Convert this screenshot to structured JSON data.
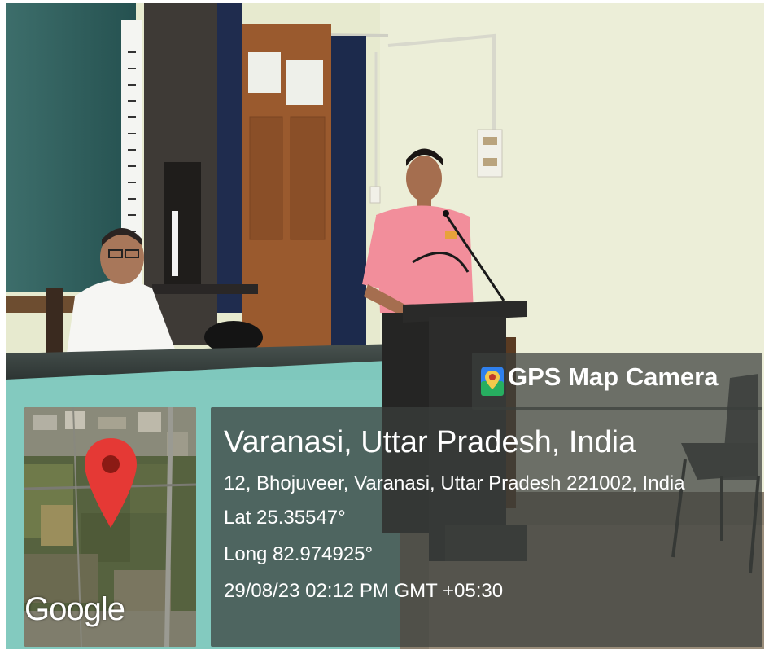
{
  "stamp": {
    "app_name": "GPS Map Camera",
    "app_icon": "map-pin-icon",
    "map_logo": "Google",
    "place": "Varanasi, Uttar Pradesh, India",
    "address": "12, Bhojuveer, Varanasi, Uttar Pradesh 221002, India",
    "latitude": "Lat 25.35547°",
    "longitude": "Long 82.974925°",
    "datetime": "29/08/23 02:12 PM GMT +05:30"
  },
  "colors": {
    "overlay": "#3a3e3c",
    "wall": "#e9ecd9",
    "shirt_pink": "#f08e9a",
    "desk_teal": "#7ec9bd",
    "pin_red": "#e53935"
  }
}
